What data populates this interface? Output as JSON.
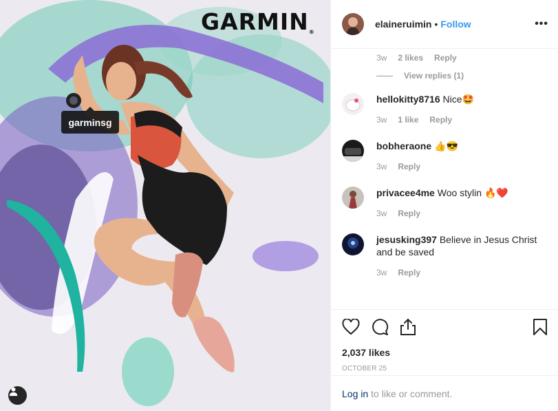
{
  "photo": {
    "brand": "GARMIN",
    "brand_mark": "®",
    "tag_label": "garminsg"
  },
  "header": {
    "username": "elaineruimin",
    "separator": "•",
    "follow_label": "Follow",
    "more_label": "•••"
  },
  "first_comment_meta": {
    "time": "3w",
    "likes": "2 likes",
    "reply": "Reply",
    "view_replies": "View replies (1)"
  },
  "comments": [
    {
      "username": "hellokitty8716",
      "text": "Nice🤩",
      "time": "3w",
      "likes": "1 like",
      "reply": "Reply"
    },
    {
      "username": "bobheraone",
      "text": "👍😎",
      "time": "3w",
      "likes": "",
      "reply": "Reply"
    },
    {
      "username": "privacee4me",
      "text": "Woo stylin 🔥❤️",
      "time": "3w",
      "likes": "",
      "reply": "Reply"
    },
    {
      "username": "jesusking397",
      "text": "Believe in Jesus Christ and be saved",
      "time": "3w",
      "likes": "",
      "reply": "Reply"
    }
  ],
  "actions": {
    "likes": "2,037 likes",
    "date": "OCTOBER 25"
  },
  "login": {
    "link": "Log in",
    "text": "to like or comment."
  },
  "icons": {
    "like": "heart-icon",
    "comment": "comment-bubble-icon",
    "share": "share-icon",
    "save": "bookmark-icon",
    "user_tag": "person-icon"
  },
  "colors": {
    "follow": "#3897f0",
    "muted": "#999999",
    "login_link": "#003569"
  }
}
